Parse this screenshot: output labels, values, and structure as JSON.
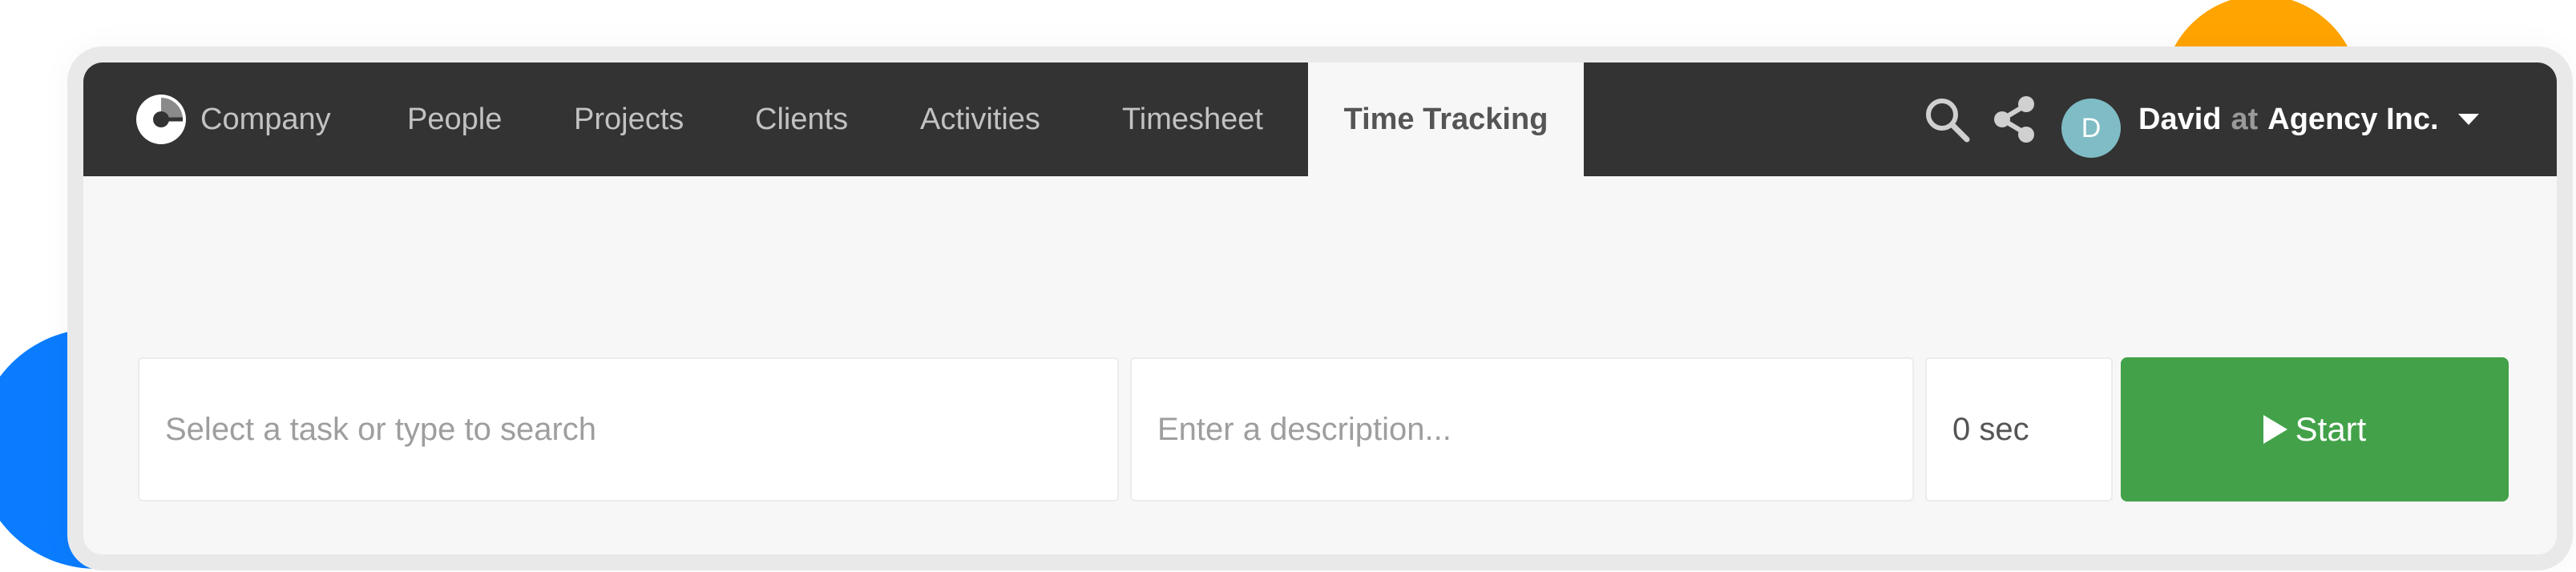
{
  "nav": {
    "brand_label": "Company",
    "items": [
      {
        "label": "People"
      },
      {
        "label": "Projects"
      },
      {
        "label": "Clients"
      },
      {
        "label": "Activities"
      },
      {
        "label": "Timesheet"
      }
    ],
    "active_label": "Time Tracking"
  },
  "account": {
    "avatar_initial": "D",
    "user": "David",
    "connector": "at",
    "company": "Agency Inc."
  },
  "tracker": {
    "task_placeholder": "Select a task or type to search",
    "description_placeholder": "Enter a description...",
    "duration": "0 sec",
    "start_label": "Start"
  },
  "colors": {
    "navbar": "#333333",
    "start_button": "#43a249",
    "avatar": "#7fbcc5",
    "accent_blue": "#0a7cff",
    "accent_orange": "#ffa400"
  },
  "icons": {
    "logo": "company-logo-icon",
    "search": "search-icon",
    "share": "share-icon",
    "dropdown": "chevron-down-icon",
    "play": "play-icon"
  }
}
